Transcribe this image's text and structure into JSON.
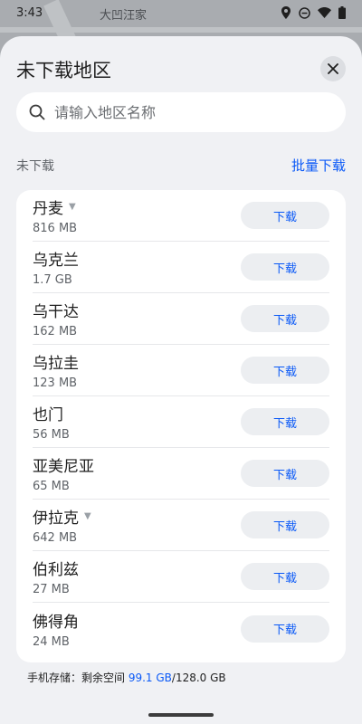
{
  "status_bar": {
    "time": "3:43",
    "map_label": "大凹汪家",
    "icons": [
      "location-icon",
      "do-not-disturb-icon",
      "wifi-icon",
      "battery-icon"
    ]
  },
  "sheet": {
    "title": "未下载地区",
    "close_icon": "close-icon"
  },
  "search": {
    "placeholder": "请输入地区名称",
    "value": ""
  },
  "section": {
    "label": "未下载",
    "batch_download": "批量下载"
  },
  "regions": [
    {
      "name": "丹麦",
      "size": "816 MB",
      "expandable": true,
      "action": "下载"
    },
    {
      "name": "乌克兰",
      "size": "1.7 GB",
      "expandable": false,
      "action": "下载"
    },
    {
      "name": "乌干达",
      "size": "162 MB",
      "expandable": false,
      "action": "下载"
    },
    {
      "name": "乌拉圭",
      "size": "123 MB",
      "expandable": false,
      "action": "下载"
    },
    {
      "name": "也门",
      "size": "56 MB",
      "expandable": false,
      "action": "下载"
    },
    {
      "name": "亚美尼亚",
      "size": "65 MB",
      "expandable": false,
      "action": "下载"
    },
    {
      "name": "伊拉克",
      "size": "642 MB",
      "expandable": true,
      "action": "下载"
    },
    {
      "name": "伯利兹",
      "size": "27 MB",
      "expandable": false,
      "action": "下载"
    },
    {
      "name": "佛得角",
      "size": "24 MB",
      "expandable": false,
      "action": "下载"
    }
  ],
  "storage": {
    "label": "手机存储：剩余空间 ",
    "free": "99.1 GB",
    "total": "/128.0 GB"
  },
  "colors": {
    "accent": "#0a59f7",
    "sheet_bg": "#f0f1f4",
    "card_bg": "#ffffff"
  }
}
